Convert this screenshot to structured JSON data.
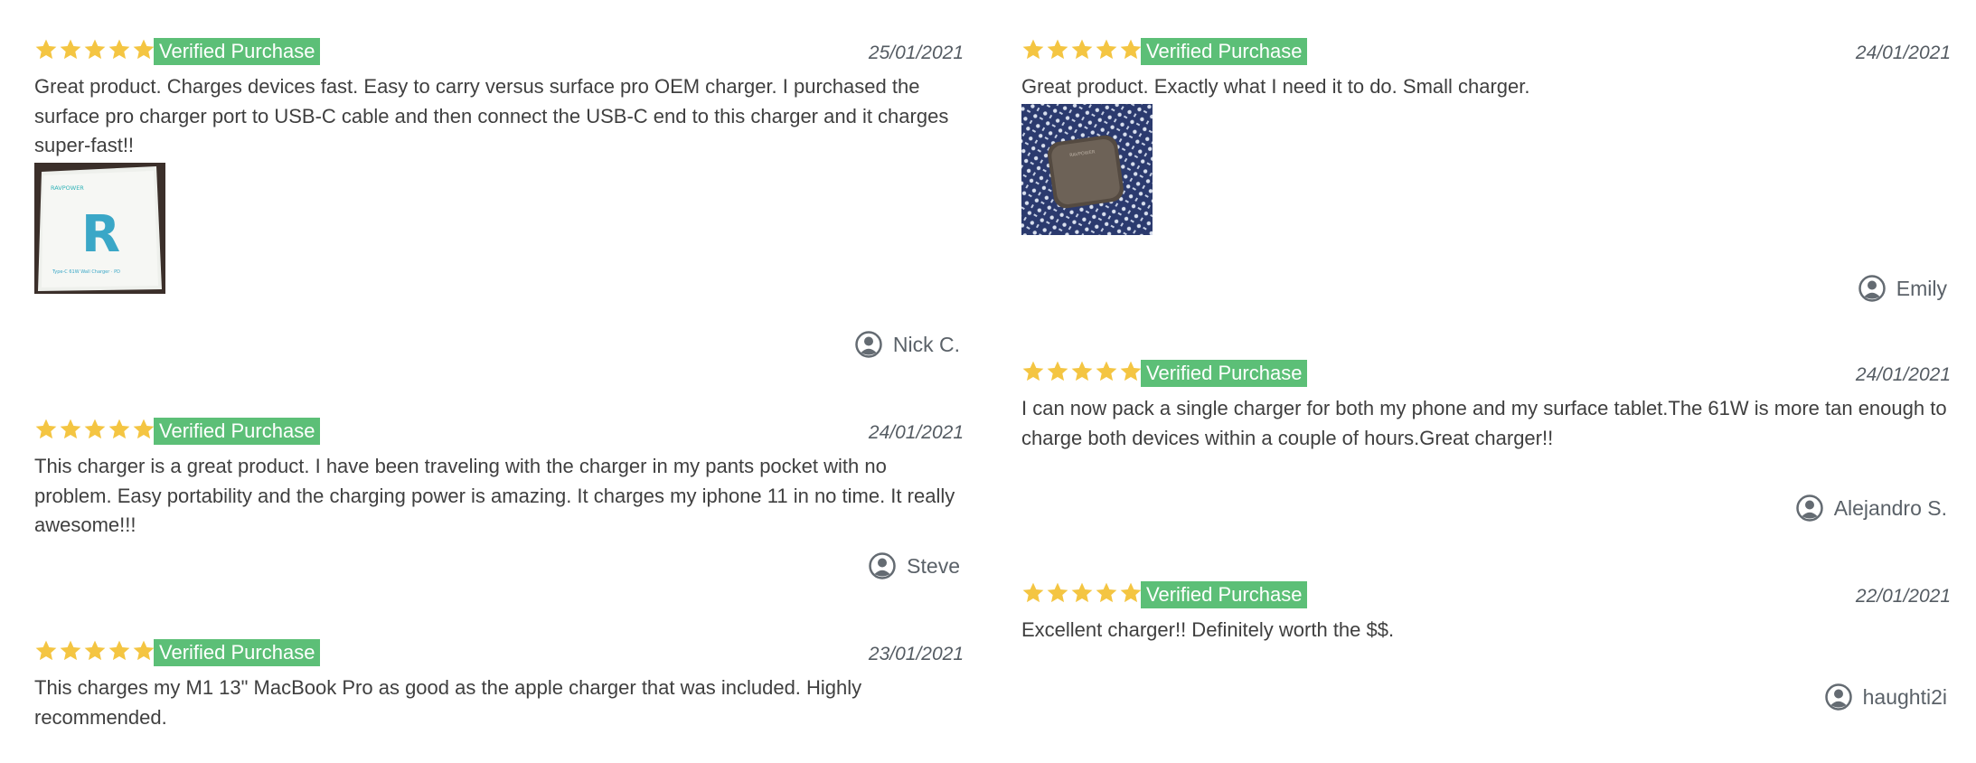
{
  "reviews": [
    {
      "rating": 5,
      "badge": "Verified Purchase",
      "date": "25/01/2021",
      "text": "Great product. Charges devices fast. Easy to carry versus surface pro OEM charger. I purchased the surface pro charger port to USB-C cable and then connect the USB-C end to this charger and it charges super-fast!!",
      "photo": {
        "brand": "RAVPOWER",
        "logo": "R",
        "caption": "Type-C 61W Wall Charger · PD"
      },
      "author": "Nick C."
    },
    {
      "rating": 5,
      "badge": "Verified Purchase",
      "date": "24/01/2021",
      "text": "This charger is a great product. I have been traveling with the charger in my pants pocket with no problem. Easy portability and the charging power is amazing. It charges my iphone 11 in no time. It really awesome!!!",
      "author": "Steve"
    },
    {
      "rating": 5,
      "badge": "Verified Purchase",
      "date": "23/01/2021",
      "text": "This charges my M1 13\" MacBook Pro as good as the apple charger that was included. Highly recommended.",
      "author": ""
    },
    {
      "rating": 5,
      "badge": "Verified Purchase",
      "date": "24/01/2021",
      "text": "Great product. Exactly what I need it to do. Small charger.",
      "photo": {
        "brand": "RAVPOWER"
      },
      "author": "Emily"
    },
    {
      "rating": 5,
      "badge": "Verified Purchase",
      "date": "24/01/2021",
      "text": "I can now pack a single charger for both my phone and my surface tablet.The 61W is more tan enough to charge both devices within a couple of hours.Great charger!!",
      "author": "Alejandro S."
    },
    {
      "rating": 5,
      "badge": "Verified Purchase",
      "date": "22/01/2021",
      "text": "Excellent charger!! Definitely worth the $$.",
      "author": "haughti2i"
    }
  ],
  "colors": {
    "star": "#f4c542",
    "badge_bg": "#5cbf77",
    "text": "#3f3f3f",
    "meta": "#5a6168"
  },
  "icons": {
    "star": "star-icon",
    "user": "user-circle-icon"
  }
}
